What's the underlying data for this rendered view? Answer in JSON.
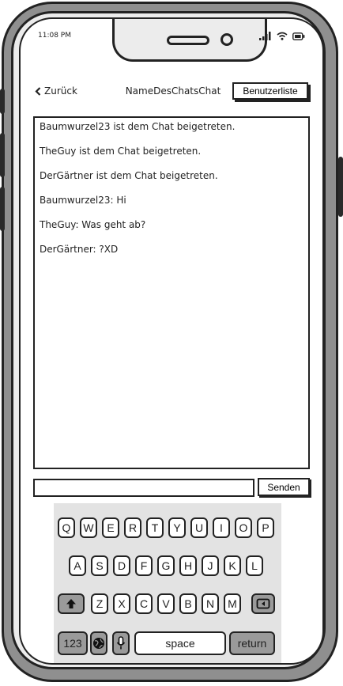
{
  "status": {
    "time": "11:08 PM"
  },
  "nav": {
    "back_label": "Zurück",
    "title": "NameDesChatsChat",
    "userlist_label": "Benutzerliste"
  },
  "messages": [
    "Baumwurzel23 ist dem Chat beigetreten.",
    "TheGuy ist dem Chat beigetreten.",
    "DerGärtner ist dem Chat beigetreten.",
    "Baumwurzel23: Hi",
    "TheGuy: Was geht ab?",
    "DerGärtner: ?XD"
  ],
  "composer": {
    "input_value": "",
    "send_label": "Senden"
  },
  "keyboard": {
    "row1": [
      "Q",
      "W",
      "E",
      "R",
      "T",
      "Y",
      "U",
      "I",
      "O",
      "P"
    ],
    "row2": [
      "A",
      "S",
      "D",
      "F",
      "G",
      "H",
      "J",
      "K",
      "L"
    ],
    "row3": [
      "Z",
      "X",
      "C",
      "V",
      "B",
      "N",
      "M"
    ],
    "numbers_label": "123",
    "space_label": "space",
    "return_label": "return"
  }
}
